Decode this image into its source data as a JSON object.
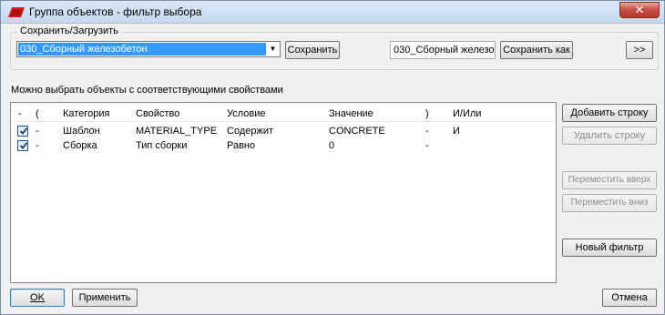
{
  "window": {
    "title": "Группа объектов - фильтр выбора",
    "close_label": "✕"
  },
  "saveload": {
    "group_label": "Сохранить/Загрузить",
    "selected_filter": "030_Сборный железобетон",
    "save_label": "Сохранить",
    "save_as_name": "030_Сборный железо",
    "save_as_label": "Сохранить как",
    "expand_label": ">>"
  },
  "hint": "Можно выбрать объекты с соответствующими свойствами",
  "table": {
    "columns": [
      "-",
      "(",
      "Категория",
      "Свойство",
      "Условие",
      "Значение",
      ")",
      "И/Или"
    ],
    "rows": [
      {
        "checked": true,
        "dash": "-",
        "open": "",
        "category": "Шаблон",
        "property": "MATERIAL_TYPE",
        "condition": "Содержит",
        "value": "CONCRETE",
        "close": "-",
        "andor": "И"
      },
      {
        "checked": true,
        "dash": "-",
        "open": "",
        "category": "Сборка",
        "property": "Тип сборки",
        "condition": "Равно",
        "value": "0",
        "close": "-",
        "andor": ""
      }
    ]
  },
  "side_buttons": {
    "add_row": "Добавить строку",
    "delete_row": "Удалить строку",
    "move_up": "Переместить вверх",
    "move_down": "Переместить вниз",
    "new_filter": "Новый фильтр"
  },
  "footer": {
    "ok": "OK",
    "apply": "Применить",
    "cancel": "Отмена"
  },
  "colors": {
    "selection": "#3399ff",
    "close_button": "#c75050",
    "app_icon": "#d42020"
  }
}
